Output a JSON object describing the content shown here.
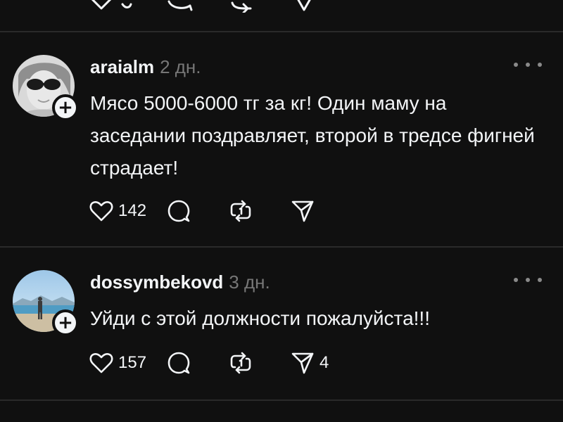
{
  "previous_post": {
    "actions": [
      {
        "icon": "heart-icon"
      },
      {
        "icon": "comment-icon"
      },
      {
        "icon": "repost-icon"
      },
      {
        "icon": "share-icon"
      }
    ]
  },
  "posts": [
    {
      "username": "araialm",
      "timestamp": "2 дн.",
      "avatar": "avatar-with-sunglasses",
      "text": "Мясо 5000-6000 тг за кг! Один маму на заседании поздравляет, второй в тредсе фигней страдает!",
      "likes": "142",
      "replies": "",
      "reposts": "",
      "shares": ""
    },
    {
      "username": "dossymbekovd",
      "timestamp": "3 дн.",
      "avatar": "avatar-beach-photo",
      "text": "Уйди с этой должности пожалуйста!!!",
      "likes": "157",
      "replies": "",
      "reposts": "",
      "shares": "4"
    }
  ],
  "icons": {
    "like": "heart-icon",
    "reply": "comment-icon",
    "repost": "repost-icon",
    "share": "share-icon",
    "follow": "plus-icon",
    "more": "more-icon"
  },
  "colors": {
    "background": "#101010",
    "text": "#f3f5f7",
    "muted": "#777777",
    "divider": "#2a2a2a"
  },
  "follow_symbol": "+"
}
